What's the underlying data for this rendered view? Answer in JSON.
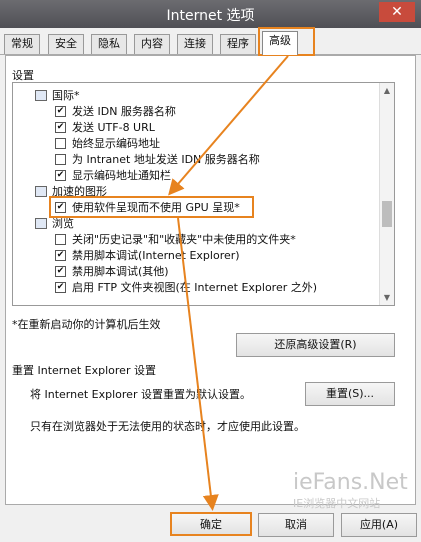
{
  "window": {
    "title": "Internet 选项",
    "close_symbol": "✕"
  },
  "tabs": [
    {
      "label": "常规"
    },
    {
      "label": "安全"
    },
    {
      "label": "隐私"
    },
    {
      "label": "内容"
    },
    {
      "label": "连接"
    },
    {
      "label": "程序"
    },
    {
      "label": "高级"
    }
  ],
  "active_tab": "高级",
  "settings": {
    "section_label": "设置",
    "items": [
      {
        "type": "category",
        "label": "国际*"
      },
      {
        "type": "checkbox",
        "label": "发送 IDN 服务器名称",
        "checked": true
      },
      {
        "type": "checkbox",
        "label": "发送 UTF-8 URL",
        "checked": true
      },
      {
        "type": "checkbox",
        "label": "始终显示编码地址",
        "checked": false
      },
      {
        "type": "checkbox",
        "label": "为 Intranet 地址发送 IDN 服务器名称",
        "checked": false
      },
      {
        "type": "checkbox",
        "label": "显示编码地址通知栏",
        "checked": true
      },
      {
        "type": "category",
        "label": "加速的图形"
      },
      {
        "type": "checkbox",
        "label": "使用软件呈现而不使用 GPU 呈现*",
        "checked": true
      },
      {
        "type": "category",
        "label": "浏览"
      },
      {
        "type": "checkbox",
        "label": "关闭\"历史记录\"和\"收藏夹\"中未使用的文件夹*",
        "checked": false
      },
      {
        "type": "checkbox",
        "label": "禁用脚本调试(Internet Explorer)",
        "checked": true
      },
      {
        "type": "checkbox",
        "label": "禁用脚本调试(其他)",
        "checked": true
      },
      {
        "type": "checkbox",
        "label": "启用 FTP 文件夹视图(在 Internet Explorer 之外)",
        "checked": true
      }
    ],
    "restart_note": "*在重新启动你的计算机后生效",
    "restore_button": "还原高级设置(R)"
  },
  "reset": {
    "heading": "重置 Internet Explorer 设置",
    "description": "将 Internet Explorer 设置重置为默认设置。",
    "button": "重置(S)...",
    "note": "只有在浏览器处于无法使用的状态时，才应使用此设置。"
  },
  "footer": {
    "ok": "确定",
    "cancel": "取消",
    "apply": "应用(A)"
  },
  "watermark": {
    "line1": "ieFans.Net",
    "line2": "IE浏览器中文网站"
  },
  "colors": {
    "annotation": "#e7831f",
    "titlebar": "#55555b",
    "close": "#c84b3c"
  }
}
